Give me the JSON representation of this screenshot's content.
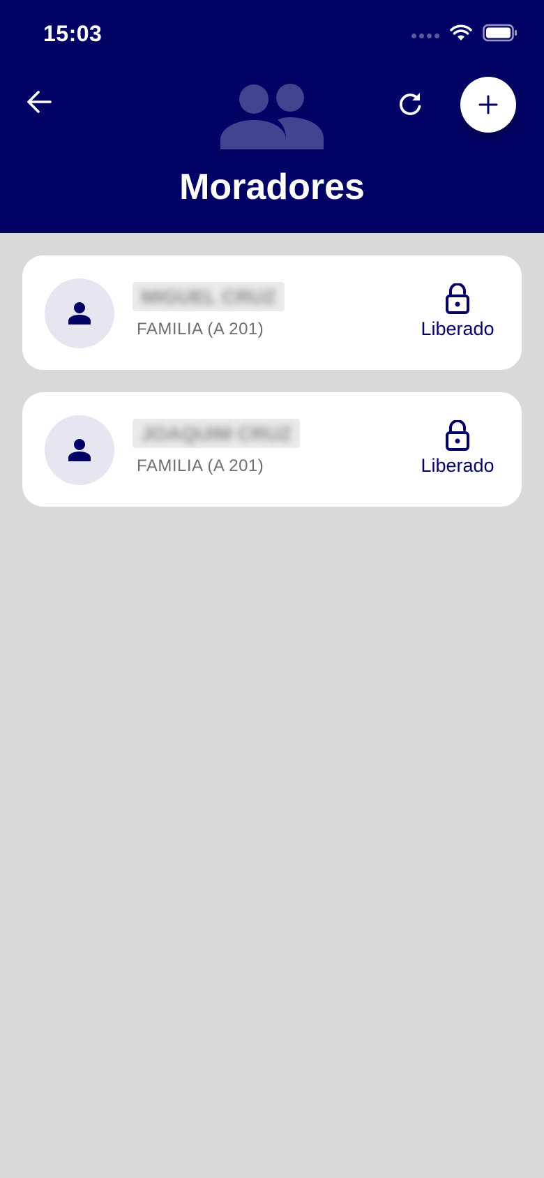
{
  "status_bar": {
    "time": "15:03"
  },
  "header": {
    "title": "Moradores"
  },
  "icons": {
    "back": "arrow-left-icon",
    "group": "group-icon",
    "refresh": "refresh-icon",
    "add": "plus-icon"
  },
  "colors": {
    "primary": "#030366",
    "background": "#d9d9d9",
    "card": "#ffffff",
    "avatar_bg": "#e6e6f0",
    "secondary_text": "#6e6e6e"
  },
  "residents": [
    {
      "name": "MIGUEL CRUZ",
      "unit": "FAMILIA (A 201)",
      "status": "Liberado"
    },
    {
      "name": "JOAQUIM CRUZ",
      "unit": "FAMILIA (A 201)",
      "status": "Liberado"
    }
  ]
}
